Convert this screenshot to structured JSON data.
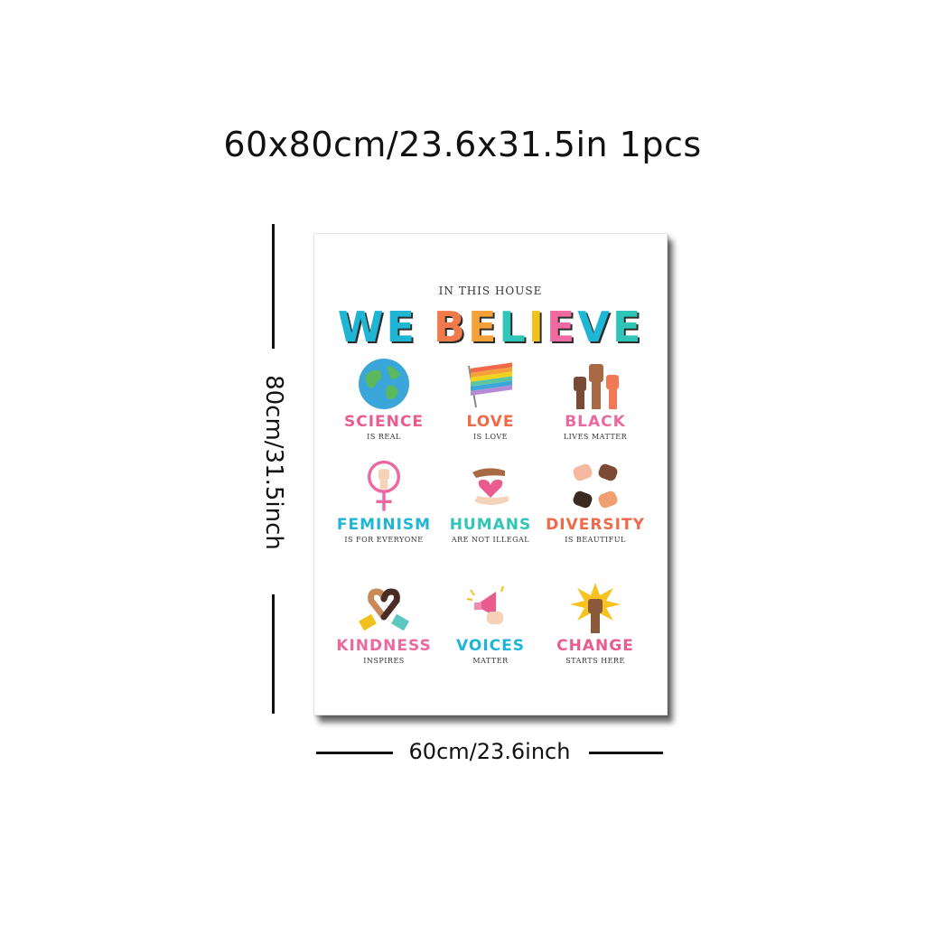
{
  "headline": "60x80cm/23.6x31.5in 1pcs",
  "dimensions": {
    "height_label": "80cm/31.5inch",
    "width_label": "60cm/23.6inch"
  },
  "poster": {
    "subtitle": "IN THIS HOUSE",
    "title_letters": [
      {
        "char": "W",
        "color": "#1fb6d6"
      },
      {
        "char": "E",
        "color": "#1fb6d6"
      },
      {
        "char": " ",
        "color": "#ffffff"
      },
      {
        "char": "B",
        "color": "#f07a4a"
      },
      {
        "char": "E",
        "color": "#f4a13a"
      },
      {
        "char": "L",
        "color": "#2fc6b7"
      },
      {
        "char": "I",
        "color": "#f3c11b"
      },
      {
        "char": "E",
        "color": "#f06aa0"
      },
      {
        "char": "V",
        "color": "#1fb6d6"
      },
      {
        "char": "E",
        "color": "#2fc6b7"
      }
    ],
    "items": [
      {
        "word": "SCIENCE",
        "tag": "IS REAL",
        "color": "#ea5c8e",
        "icon": "globe-icon"
      },
      {
        "word": "LOVE",
        "tag": "IS LOVE",
        "color": "#f06a4a",
        "icon": "rainbow-flag-icon"
      },
      {
        "word": "BLACK",
        "tag": "LIVES MATTER",
        "color": "#ea6aa0",
        "icon": "raised-fists-icon"
      },
      {
        "word": "FEMINISM",
        "tag": "IS FOR EVERYONE",
        "color": "#1fb6d6",
        "icon": "female-fist-icon"
      },
      {
        "word": "HUMANS",
        "tag": "ARE NOT ILLEGAL",
        "color": "#2fc6b7",
        "icon": "hands-heart-icon"
      },
      {
        "word": "DIVERSITY",
        "tag": "IS BEAUTIFUL",
        "color": "#ef6a4a",
        "icon": "diverse-hands-icon"
      },
      {
        "word": "KINDNESS",
        "tag": "INSPIRES",
        "color": "#ea6aa0",
        "icon": "heart-hands-icon"
      },
      {
        "word": "VOICES",
        "tag": "MATTER",
        "color": "#1fb6d6",
        "icon": "megaphone-icon"
      },
      {
        "word": "CHANGE",
        "tag": "STARTS HERE",
        "color": "#ea5c8e",
        "icon": "starburst-fist-icon"
      }
    ]
  }
}
